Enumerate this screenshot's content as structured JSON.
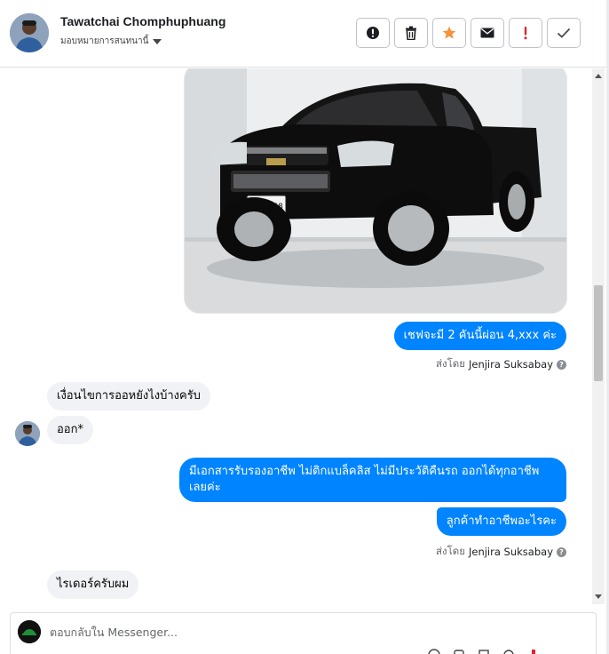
{
  "header": {
    "name": "Tawatchai Chomphuphuang",
    "assign_label": "มอบหมายการสนทนานี้",
    "tools": [
      {
        "icon": "alert-circle-icon"
      },
      {
        "icon": "trash-icon"
      },
      {
        "icon": "star-icon"
      },
      {
        "icon": "envelope-icon"
      },
      {
        "icon": "exclamation-icon"
      },
      {
        "icon": "checkmark-icon"
      }
    ]
  },
  "messages": [
    {
      "side": "out",
      "text": "เชฟจะมี 2 คันนี้ผ่อน 4,xxx ค่ะ"
    },
    {
      "side": "meta",
      "prefix": "ส่งโดย",
      "agent": "Jenjira Suksabay"
    },
    {
      "side": "in",
      "text": "เงื่อนไขการออหยังไงบ้างครับ"
    },
    {
      "side": "in",
      "text": "ออก*"
    },
    {
      "side": "out",
      "text": "มีเอกสารรับรองอาชีพ ไม่ติกแบล็คลิส ไม่มีประวัติคืนรถ ออกได้ทุกอาชีพเลยค่ะ"
    },
    {
      "side": "out",
      "text": "ลูกค้าทำอาชีพอะไรคะ"
    },
    {
      "side": "meta",
      "prefix": "ส่งโดย",
      "agent": "Jenjira Suksabay"
    },
    {
      "side": "in",
      "text": "ไรเดอร์ครับผม"
    }
  ],
  "photo": {
    "plate_text": "บน 9858"
  },
  "reply": {
    "placeholder": "ตอบกลับใน Messenger..."
  },
  "colors": {
    "outgoing_bubble": "#0084ff",
    "incoming_bubble": "#f0f2f5",
    "star": "#f7923a",
    "exclamation": "#e0242a"
  }
}
